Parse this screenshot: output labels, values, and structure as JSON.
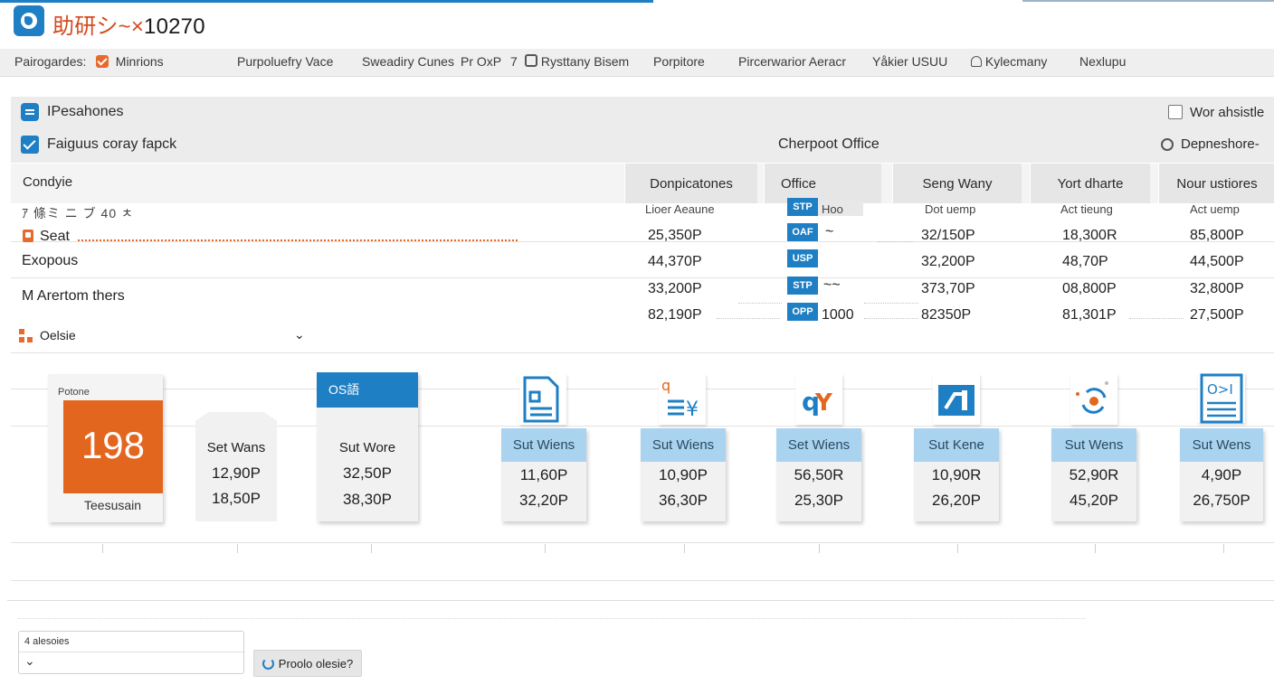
{
  "window": {
    "title_cjk": "助研シ~×",
    "title_num": "10270"
  },
  "menubar": [
    "Pairogardes:",
    "Minrions",
    "Purpoluefry Vace",
    "Sweadiry Cunes",
    "Pr OxP",
    "7",
    "Rysttany Bisem",
    "Porpitore",
    "Pircerwarior Aeracr",
    "Yåkier USUU",
    "Kylecmany",
    "Nexlupu"
  ],
  "panel": {
    "title": "IPesahones",
    "checkbox_label": "Faiguus coray fapck",
    "center_label": "Cherpoot Office",
    "right_option": "Wor ahsistle",
    "right_radio": "Depneshore-"
  },
  "table": {
    "first_col": "Condyie",
    "columns": [
      "Donpicatones",
      "Office",
      "Seng Wany",
      "Yort dharte",
      "Nour ustiores"
    ],
    "subheaders": {
      "left": "ｱ 條ミ ニ ブ 40 ㅊ",
      "c1": "Lioer Aeaune",
      "c2": "Hoo",
      "c3": "Dot uemp",
      "c4": "Act tieung",
      "c5": "Act uemp"
    },
    "rows": [
      {
        "label": "Seat",
        "c1": "25,350P",
        "tag": "OAF",
        "note": "~",
        "c3": "32/150P",
        "c4": "18,300R",
        "c5": "85,800P"
      },
      {
        "label": "Exopous",
        "c1": "44,370P",
        "tag": "USP",
        "note": "",
        "c3": "32,200P",
        "c4": "48,70P",
        "c5": "44,500P"
      },
      {
        "label": "M Arertom thers",
        "c1": "33,200P",
        "tag": "STP",
        "note": "~~",
        "c3": "373,70P",
        "c4": "08,800P",
        "c5": "32,800P"
      },
      {
        "label": "",
        "c1": "82,190P",
        "tag": "OPP",
        "note": "1000",
        "c3": "82350P",
        "c4": "81,301P",
        "c5": "27,500P"
      }
    ],
    "first_tag": "STP",
    "dropdown_label": "Oelsie"
  },
  "cards": {
    "feature": {
      "top": "Potone",
      "number": "198",
      "bottom": "Teesusain"
    },
    "plain": {
      "title": "Set Wans",
      "v1": "12,90P",
      "v2": "18,50P"
    },
    "os": {
      "badge": "OS語",
      "title": "Sut Wore",
      "v1": "32,50P",
      "v2": "38,30P"
    },
    "icon_cards": [
      {
        "icon": "document-chart-icon",
        "title": "Sut Wiens",
        "v1": "11,60P",
        "v2": "32,20P"
      },
      {
        "icon": "yen-invoice-icon",
        "title": "Sut Wiens",
        "v1": "10,90P",
        "v2": "36,30P"
      },
      {
        "icon": "q-y-logo-icon",
        "title": "Set Wiens",
        "v1": "56,50R",
        "v2": "25,30P"
      },
      {
        "icon": "chart-box-icon",
        "title": "Sut Kene",
        "v1": "10,90R",
        "v2": "26,20P"
      },
      {
        "icon": "sync-icon",
        "title": "Sut Wens",
        "v1": "52,90R",
        "v2": "45,20P"
      },
      {
        "icon": "code-document-icon",
        "title": "Sut Wens",
        "v1": "4,90P",
        "v2": "26,750P"
      }
    ]
  },
  "bottom": {
    "select_label": "4 alesoies",
    "button_label": "Proolo olesie?"
  },
  "colors": {
    "accent": "#1f7fc4",
    "orange": "#e8692c",
    "card_head": "#a9d3ef"
  }
}
